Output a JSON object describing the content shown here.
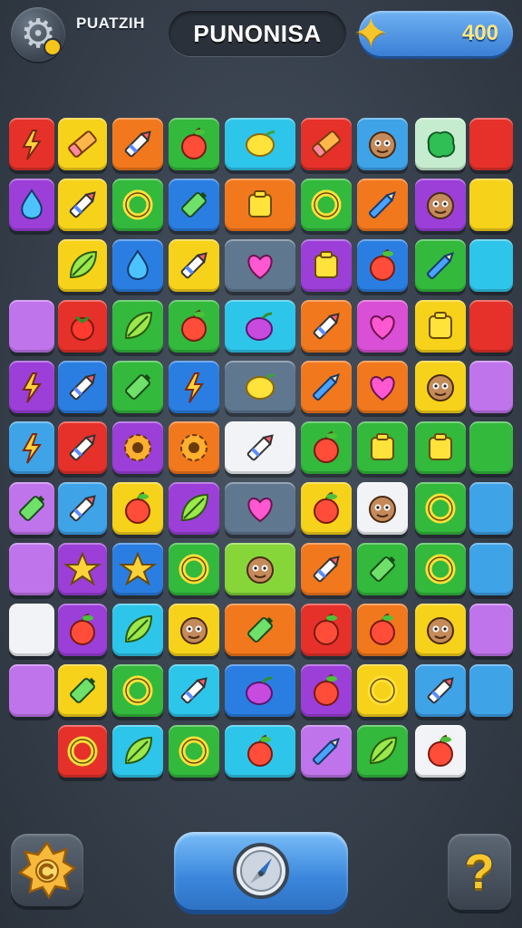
{
  "header": {
    "player_name": "PUATZIH",
    "title": "PUNONISA",
    "score": "400",
    "icons": {
      "settings": "gear-icon",
      "score": "star-icon"
    }
  },
  "palette": {
    "red": "#e5312a",
    "yellow": "#f7d21a",
    "orange": "#f2781d",
    "green": "#33b93c",
    "lime": "#86d63a",
    "cyan": "#2ec5ea",
    "blue": "#2a7ee2",
    "purple": "#9b3fd8",
    "magenta": "#d94fd5",
    "lavender": "#c074ec",
    "slate": "#607790",
    "white": "#f1f3f6",
    "pastel": "#c6ecd0",
    "skyblue": "#3fa3e8"
  },
  "board": {
    "rows": [
      [
        [
          "red",
          "lightning"
        ],
        [
          "yellow",
          "eraser"
        ],
        [
          "orange",
          "crayon"
        ],
        [
          "green",
          "apple"
        ],
        [
          "cyan",
          "lemon"
        ],
        [
          "red",
          "eraser"
        ],
        [
          "skyblue",
          "face"
        ],
        [
          "pastel",
          "blob"
        ],
        [
          "red",
          "none"
        ]
      ],
      [
        [
          "purple",
          "drop"
        ],
        [
          "yellow",
          "crayon"
        ],
        [
          "green",
          "ring"
        ],
        [
          "blue",
          "battery"
        ],
        [
          "orange",
          "square"
        ],
        [
          "green",
          "ring"
        ],
        [
          "orange",
          "pen"
        ],
        [
          "purple",
          "face"
        ],
        [
          "yellow",
          "none"
        ]
      ],
      [
        null,
        [
          "yellow",
          "leaf"
        ],
        [
          "blue",
          "drop"
        ],
        [
          "yellow",
          "crayon"
        ],
        [
          "slate",
          "heart"
        ],
        [
          "purple",
          "square"
        ],
        [
          "blue",
          "apple"
        ],
        [
          "green",
          "pen"
        ],
        [
          "cyan",
          "none"
        ]
      ],
      [
        [
          "lavender",
          "none"
        ],
        [
          "red",
          "berry"
        ],
        [
          "green",
          "leaf"
        ],
        [
          "green",
          "apple"
        ],
        [
          "cyan",
          "plum"
        ],
        [
          "orange",
          "crayon"
        ],
        [
          "magenta",
          "heart"
        ],
        [
          "yellow",
          "square"
        ],
        [
          "red",
          "none"
        ]
      ],
      [
        [
          "purple",
          "lightning"
        ],
        [
          "blue",
          "crayon"
        ],
        [
          "green",
          "battery"
        ],
        [
          "blue",
          "lightning"
        ],
        [
          "slate",
          "lemon"
        ],
        [
          "orange",
          "pen"
        ],
        [
          "orange",
          "heart"
        ],
        [
          "yellow",
          "face"
        ],
        [
          "lavender",
          "none"
        ]
      ],
      [
        [
          "skyblue",
          "lightning"
        ],
        [
          "red",
          "crayon"
        ],
        [
          "purple",
          "gear"
        ],
        [
          "orange",
          "gear"
        ],
        [
          "white",
          "crayon"
        ],
        [
          "green",
          "apple"
        ],
        [
          "green",
          "square"
        ],
        [
          "green",
          "square"
        ],
        [
          "green",
          "none"
        ]
      ],
      [
        [
          "lavender",
          "battery"
        ],
        [
          "skyblue",
          "crayon"
        ],
        [
          "yellow",
          "apple"
        ],
        [
          "purple",
          "leaf"
        ],
        [
          "slate",
          "heart"
        ],
        [
          "yellow",
          "apple"
        ],
        [
          "white",
          "face"
        ],
        [
          "green",
          "ring"
        ],
        [
          "skyblue",
          "none"
        ]
      ],
      [
        [
          "lavender",
          "none"
        ],
        [
          "purple",
          "star"
        ],
        [
          "blue",
          "star"
        ],
        [
          "green",
          "ring"
        ],
        [
          "lime",
          "face"
        ],
        [
          "orange",
          "crayon"
        ],
        [
          "green",
          "battery"
        ],
        [
          "green",
          "ring"
        ],
        [
          "skyblue",
          "none"
        ]
      ],
      [
        [
          "white",
          "none"
        ],
        [
          "purple",
          "apple"
        ],
        [
          "cyan",
          "leaf"
        ],
        [
          "yellow",
          "face"
        ],
        [
          "orange",
          "battery"
        ],
        [
          "red",
          "apple"
        ],
        [
          "orange",
          "apple"
        ],
        [
          "yellow",
          "face"
        ],
        [
          "lavender",
          "none"
        ]
      ],
      [
        [
          "lavender",
          "none"
        ],
        [
          "yellow",
          "battery"
        ],
        [
          "green",
          "ring"
        ],
        [
          "cyan",
          "crayon"
        ],
        [
          "blue",
          "plum"
        ],
        [
          "purple",
          "apple"
        ],
        [
          "yellow",
          "ring"
        ],
        [
          "skyblue",
          "crayon"
        ],
        [
          "skyblue",
          "none"
        ]
      ],
      [
        null,
        [
          "red",
          "ring"
        ],
        [
          "cyan",
          "leaf"
        ],
        [
          "green",
          "ring"
        ],
        [
          "cyan",
          "apple"
        ],
        [
          "lavender",
          "pen"
        ],
        [
          "green",
          "leaf"
        ],
        [
          "white",
          "apple"
        ],
        null
      ]
    ]
  },
  "footer": {
    "help_label": "?",
    "icons": {
      "powerup": "sun-badge-icon",
      "shuffle": "compass-icon",
      "help": "question-icon"
    }
  }
}
